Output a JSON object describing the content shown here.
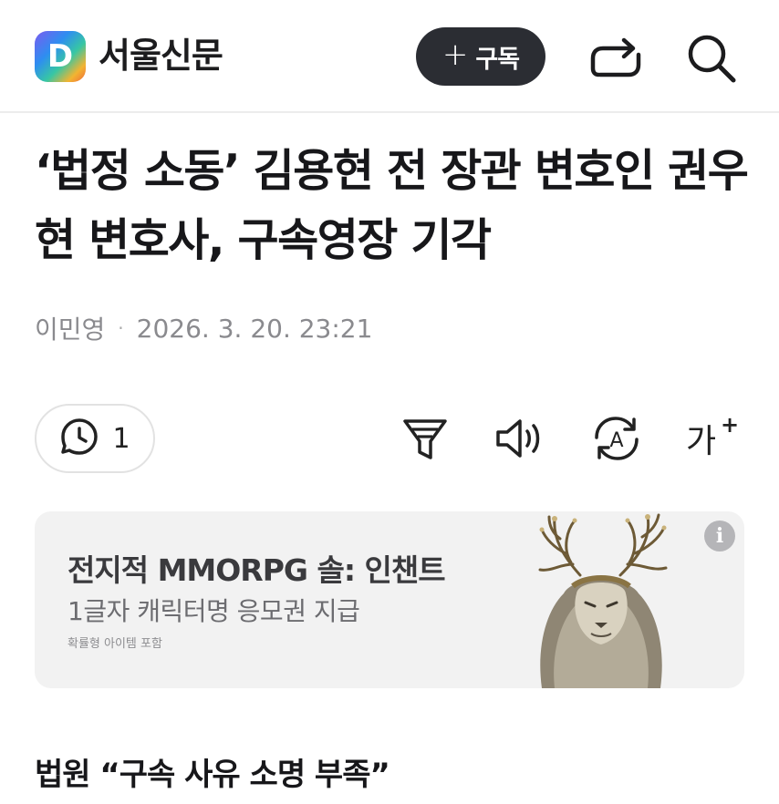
{
  "header": {
    "logo_letter": "D",
    "brand": "서울신문",
    "subscribe_plus": "+",
    "subscribe_label": "구독"
  },
  "article": {
    "headline": "‘법정 소동’ 김용현 전 장관 변호인 권우현 변호사, 구속영장 기각",
    "author": "이민영",
    "separator": "·",
    "datetime": "2026. 3. 20. 23:21",
    "subheading": "법원 “구속 사유 소명 부족”"
  },
  "toolbar": {
    "comment_count": "1",
    "font_label": "가",
    "font_plus": "+",
    "translate_letter": "A"
  },
  "ad": {
    "title": "전지적 MMORPG 솔: 인챈트",
    "subtitle": "1글자 캐릭터명 응모권 지급",
    "note": "확률형 아이템 포함",
    "info_glyph": "i"
  },
  "icons": [
    "logo",
    "plus-icon",
    "share-icon",
    "search-icon",
    "comment-clock-icon",
    "summary-filter-icon",
    "speaker-icon",
    "translate-icon",
    "font-size-icon",
    "info-icon"
  ]
}
